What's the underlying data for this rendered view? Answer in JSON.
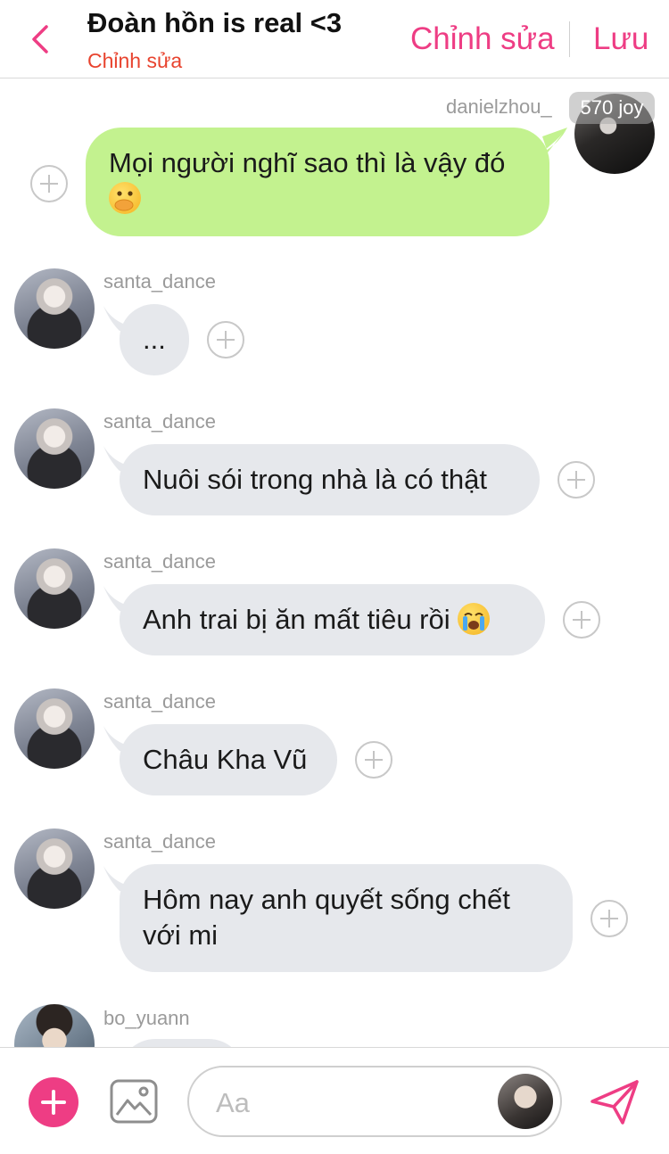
{
  "header": {
    "title": "Đoàn hồn is real <3",
    "subtitle": "Chỉnh sửa",
    "edit_label": "Chỉnh sửa",
    "save_label": "Lưu"
  },
  "messages": [
    {
      "user": "danielzhou_",
      "badge": "570 joy",
      "text": "Mọi người nghĩ sao thì là vậy đó",
      "emoji": "face-with-hand-over-mouth",
      "direction": "out"
    },
    {
      "user": "santa_dance",
      "text": "...",
      "direction": "in"
    },
    {
      "user": "santa_dance",
      "text": "Nuôi sói trong nhà là có thật",
      "direction": "in"
    },
    {
      "user": "santa_dance",
      "text": "Anh trai bị ăn mất tiêu rồi",
      "emoji": "loudly-crying-face",
      "direction": "in"
    },
    {
      "user": "santa_dance",
      "text": "Châu Kha Vũ",
      "direction": "in"
    },
    {
      "user": "santa_dance",
      "text_line1": "Hôm nay anh quyết sống chết",
      "text_line2": "với mi",
      "direction": "in"
    },
    {
      "user": "bo_yuann",
      "direction": "in"
    }
  ],
  "composer": {
    "placeholder": "Aa"
  },
  "colors": {
    "accent": "#ee3d84",
    "subtitle": "#e8432e",
    "bubble_out": "#c3f28f",
    "bubble_in": "#e6e8ec"
  }
}
